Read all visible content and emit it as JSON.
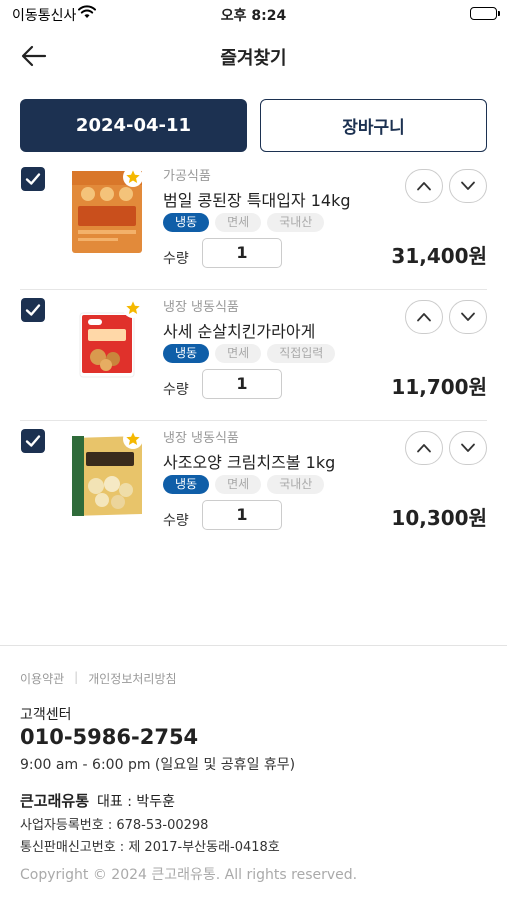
{
  "status_bar": {
    "carrier": "이동통신사",
    "time": "오후 8:24"
  },
  "header": {
    "title": "즐겨찾기"
  },
  "actions": {
    "date_label": "2024-04-11",
    "cart_label": "장바구니"
  },
  "items": [
    {
      "category": "가공식품",
      "name": "범일 콩된장 특대입자 14kg",
      "tags": [
        "냉동",
        "면세",
        "국내산"
      ],
      "qty_label": "수량",
      "qty": "1",
      "price": "31,400원",
      "thumb_text": "콩된장"
    },
    {
      "category": "냉장 냉동식품",
      "name": "사세 순살치킨가라아게",
      "tags": [
        "냉동",
        "면세",
        "직접입력"
      ],
      "qty_label": "수량",
      "qty": "1",
      "price": "11,700원",
      "thumb_text": "순살치킨가라아게"
    },
    {
      "category": "냉장 냉동식품",
      "name": "사조오양 크림치즈볼 1kg",
      "tags": [
        "냉동",
        "면세",
        "국내산"
      ],
      "qty_label": "수량",
      "qty": "1",
      "price": "10,300원",
      "thumb_text": "크림치즈볼"
    }
  ],
  "footer": {
    "terms": "이용약관",
    "privacy": "개인정보처리방침",
    "cs_label": "고객센터",
    "phone": "010-5986-2754",
    "hours": "9:00 am - 6:00 pm (일요일 및 공휴일 휴무)",
    "company_name": "큰고래유통",
    "ceo": "대표 : 박두훈",
    "business_reg": "사업자등록번호 : 678-53-00298",
    "mail_order": "통신판매신고번호 : 제 2017-부산동래-0418호",
    "copyright": "Copyright © 2024 큰고래유통. All rights reserved."
  },
  "colors": {
    "primary": "#1c3151",
    "tag_blue": "#0f5ea8",
    "star": "#f5b800"
  }
}
